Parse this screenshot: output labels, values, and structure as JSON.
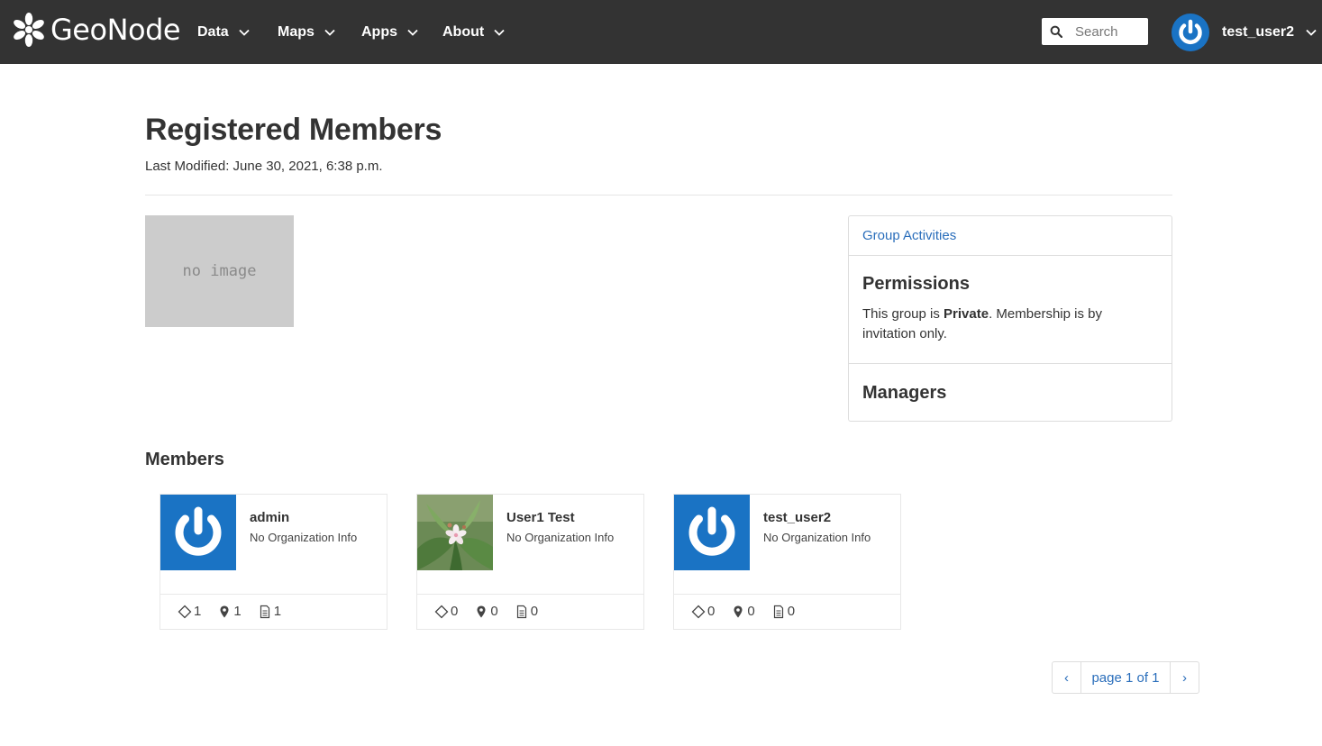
{
  "navbar": {
    "brand": "GeoNode",
    "menus": [
      {
        "label": "Data"
      },
      {
        "label": "Maps"
      },
      {
        "label": "Apps"
      },
      {
        "label": "About"
      }
    ],
    "search_placeholder": "Search",
    "username": "test_user2"
  },
  "header": {
    "title": "Registered Members",
    "last_modified": "Last Modified: June 30, 2021, 6:38 p.m."
  },
  "group_image": {
    "placeholder_text": "no image"
  },
  "side_panel": {
    "activities_link": "Group Activities",
    "permissions_title": "Permissions",
    "permissions_prefix": "This group is ",
    "permissions_value": "Private",
    "permissions_suffix": ". Membership is by invitation only.",
    "managers_title": "Managers"
  },
  "members": {
    "title": "Members",
    "items": [
      {
        "name": "admin",
        "org": "No Organization Info",
        "layers": "1",
        "maps": "1",
        "documents": "1",
        "avatar": "default-power-icon"
      },
      {
        "name": "User1 Test",
        "org": "No Organization Info",
        "layers": "0",
        "maps": "0",
        "documents": "0",
        "avatar": "flower-photo"
      },
      {
        "name": "test_user2",
        "org": "No Organization Info",
        "layers": "0",
        "maps": "0",
        "documents": "0",
        "avatar": "default-power-icon"
      }
    ]
  },
  "pagination": {
    "label": "page 1 of 1",
    "prev": "‹",
    "next": "›"
  },
  "colors": {
    "navbar_bg": "#333333",
    "link": "#2a6ebb",
    "avatar_blue": "#1a73c4"
  }
}
